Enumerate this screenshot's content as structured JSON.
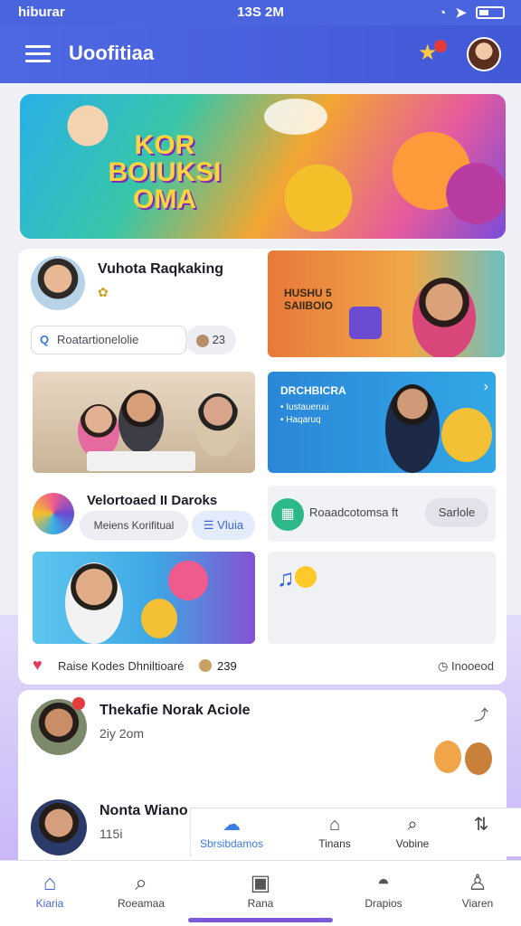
{
  "status_bar": {
    "carrier": "hiburar",
    "time": "13S 2M"
  },
  "app_bar": {
    "title": "Uoofitiaa",
    "notification_count": ""
  },
  "hero": {
    "title": "KOR BOIUKSI OMA"
  },
  "profile_card": {
    "name": "Vuhota Raqkaking",
    "badge": "",
    "search_placeholder": "Roatartionelolie",
    "count": "23"
  },
  "promo_tile_a": {
    "text": "HUSHU 5 SAIIBOIO"
  },
  "promo_tile_b": {
    "title": "DRCHBICRA",
    "line1": "• Iustaueruu",
    "line2": "• Haqaruq"
  },
  "mid_row": {
    "title": "Velortoaed II Daroks",
    "pill_label": "Meiens Korifitual",
    "pill_action": "Vluia",
    "search_label": "Roaadcotomsa ft",
    "search_button": "Sarlole"
  },
  "footer_row": {
    "left_text": "Raise Kodes Dhniltioaré",
    "count": "239",
    "right_text": "Inooeod"
  },
  "feed": [
    {
      "name": "Thekafie Norak Aciole",
      "meta": "2iy 2om"
    },
    {
      "name": "Nonta Wiano",
      "meta": "115i"
    }
  ],
  "sub_tabs": [
    {
      "label": "Sbrsibdamos",
      "icon": "cloud-icon"
    },
    {
      "label": "Tinans",
      "icon": "bell-icon"
    },
    {
      "label": "Vobine",
      "icon": "search-icon"
    },
    {
      "label": "",
      "icon": "filter-icon"
    }
  ],
  "bottom_nav": [
    {
      "label": "Kiaria",
      "icon": "home-icon"
    },
    {
      "label": "Roeamaa",
      "icon": "search-icon"
    },
    {
      "label": "Rana",
      "icon": "board-icon"
    },
    {
      "label": "Drapios",
      "icon": "chat-icon"
    },
    {
      "label": "Viaren",
      "icon": "profile-icon"
    }
  ],
  "colors": {
    "primary": "#4a64de",
    "accent": "#3b7be8",
    "badge": "#e53b3b"
  }
}
